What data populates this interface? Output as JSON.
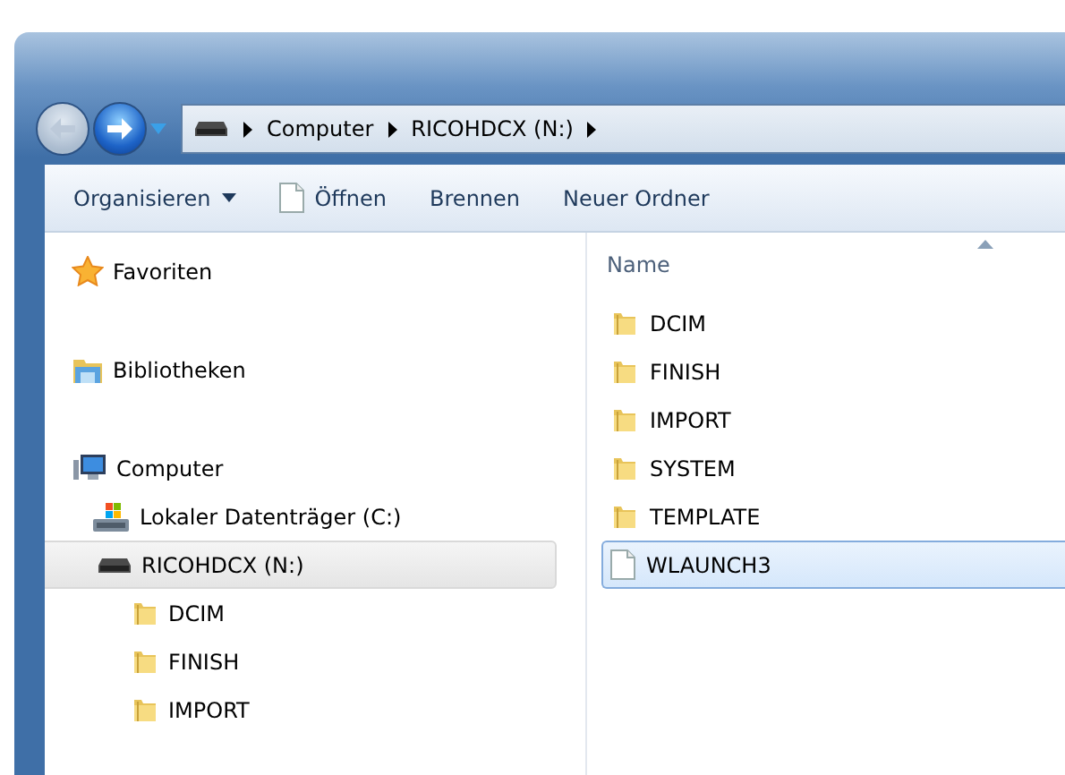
{
  "navigation": {
    "back_enabled": false,
    "forward_enabled": true
  },
  "address_bar": {
    "crumbs": [
      "Computer",
      "RICOHDCX (N:)"
    ]
  },
  "toolbar": [
    {
      "label": "Organisieren",
      "kind": "menu"
    },
    {
      "label": "Öffnen",
      "kind": "open"
    },
    {
      "label": "Brennen",
      "kind": "plain"
    },
    {
      "label": "Neuer Ordner",
      "kind": "plain"
    }
  ],
  "nav_pane": [
    {
      "label": "Favoriten",
      "kind": "star",
      "selected": false
    },
    {
      "label": "Bibliotheken",
      "kind": "library",
      "selected": false
    },
    {
      "label": "Computer",
      "kind": "computer",
      "selected": false,
      "children": [
        {
          "label": "Lokaler Datenträger (C:)",
          "kind": "system-drive",
          "selected": false
        },
        {
          "label": "RICOHDCX (N:)",
          "kind": "drive",
          "selected": true,
          "children": [
            {
              "label": "DCIM",
              "kind": "folder",
              "selected": false
            },
            {
              "label": "FINISH",
              "kind": "folder",
              "selected": false
            },
            {
              "label": "IMPORT",
              "kind": "folder",
              "selected": false
            }
          ]
        }
      ]
    }
  ],
  "file_list": {
    "column": "Name",
    "items": [
      {
        "name": "DCIM",
        "kind": "folder",
        "selected": false
      },
      {
        "name": "FINISH",
        "kind": "folder",
        "selected": false
      },
      {
        "name": "IMPORT",
        "kind": "folder",
        "selected": false
      },
      {
        "name": "SYSTEM",
        "kind": "folder",
        "selected": false
      },
      {
        "name": "TEMPLATE",
        "kind": "folder",
        "selected": false
      },
      {
        "name": "WLAUNCH3",
        "kind": "file",
        "selected": true
      }
    ]
  }
}
